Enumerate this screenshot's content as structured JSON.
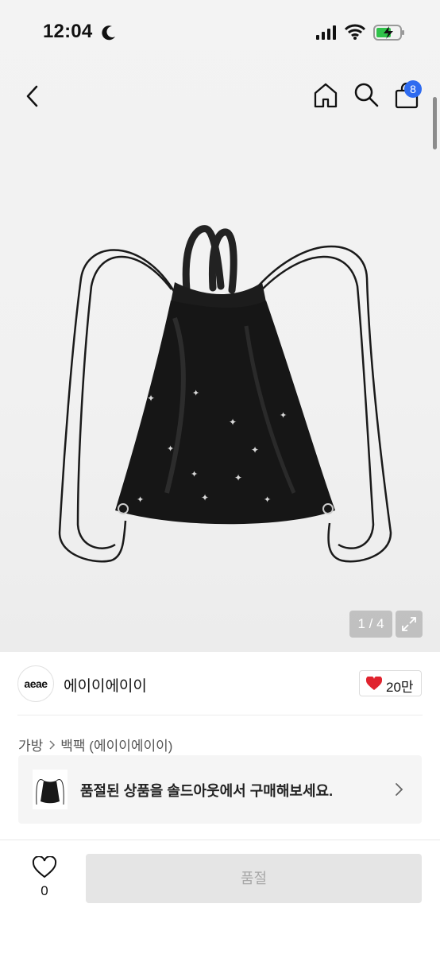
{
  "status_bar": {
    "time": "12:04",
    "icons": [
      "moon-icon",
      "signal-icon",
      "wifi-icon",
      "battery-charging-icon"
    ]
  },
  "nav": {
    "cart_badge": "8",
    "icons": [
      "back-chevron-icon",
      "home-icon",
      "search-icon",
      "shopping-bag-icon"
    ]
  },
  "gallery": {
    "pager": "1 / 4",
    "image": "black leather drawstring backpack with star embroidery"
  },
  "shop": {
    "logo_text": "aeae",
    "name": "에이이에이이",
    "like_count": "20만"
  },
  "breadcrumb": {
    "category": "가방",
    "subcategory": "백팩 (에이이에이이)"
  },
  "banner": {
    "text": "품절된 상품을 솔드아웃에서 구매해보세요."
  },
  "bottom_bar": {
    "wish_count": "0",
    "button_label": "품절"
  },
  "colors": {
    "badge": "#2e6bf0",
    "heart": "#e0232e",
    "disabled_button": "#e5e5e5"
  }
}
